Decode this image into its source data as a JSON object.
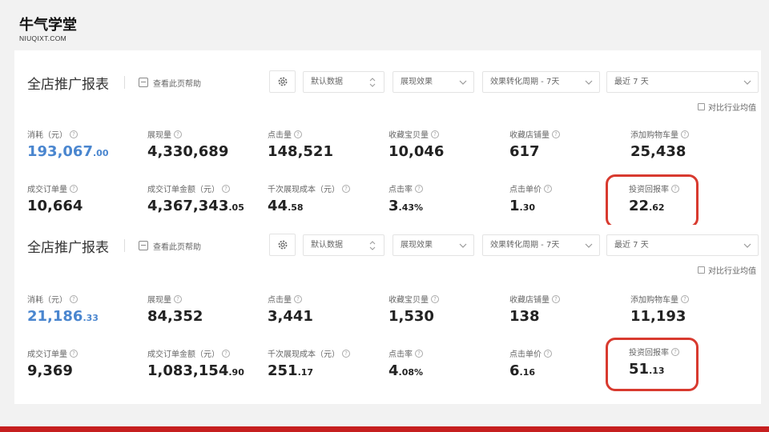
{
  "logo": {
    "main": "牛气学堂",
    "sub": "NIUQIXT.COM"
  },
  "panels": [
    {
      "title": "全店推广报表",
      "help": "查看此页帮助",
      "selects": [
        "默认数据",
        "展现效果",
        "效果转化周期 - 7天",
        "最近 7 天"
      ],
      "compare": "对比行业均值",
      "metrics": [
        {
          "label": "消耗（元）",
          "main": "193,067",
          "small": ".00"
        },
        {
          "label": "展现量",
          "main": "4,330,689",
          "small": ""
        },
        {
          "label": "点击量",
          "main": "148,521",
          "small": ""
        },
        {
          "label": "收藏宝贝量",
          "main": "10,046",
          "small": ""
        },
        {
          "label": "收藏店铺量",
          "main": "617",
          "small": ""
        },
        {
          "label": "添加购物车量",
          "main": "25,438",
          "small": ""
        },
        {
          "label": "成交订单量",
          "main": "10,664",
          "small": ""
        },
        {
          "label": "成交订单金额（元）",
          "main": "4,367,343",
          "small": ".05"
        },
        {
          "label": "千次展现成本（元）",
          "main": "44",
          "small": ".58"
        },
        {
          "label": "点击率",
          "main": "3",
          "small": ".43%"
        },
        {
          "label": "点击单价",
          "main": "1",
          "small": ".30"
        },
        {
          "label": "投资回报率",
          "main": "22",
          "small": ".62"
        }
      ]
    },
    {
      "title": "全店推广报表",
      "help": "查看此页帮助",
      "selects": [
        "默认数据",
        "展现效果",
        "效果转化周期 - 7天",
        "最近 7 天"
      ],
      "compare": "对比行业均值",
      "metrics": [
        {
          "label": "消耗（元）",
          "main": "21,186",
          "small": ".33"
        },
        {
          "label": "展现量",
          "main": "84,352",
          "small": ""
        },
        {
          "label": "点击量",
          "main": "3,441",
          "small": ""
        },
        {
          "label": "收藏宝贝量",
          "main": "1,530",
          "small": ""
        },
        {
          "label": "收藏店铺量",
          "main": "138",
          "small": ""
        },
        {
          "label": "添加购物车量",
          "main": "11,193",
          "small": ""
        },
        {
          "label": "成交订单量",
          "main": "9,369",
          "small": ""
        },
        {
          "label": "成交订单金额（元）",
          "main": "1,083,154",
          "small": ".90"
        },
        {
          "label": "千次展现成本（元）",
          "main": "251",
          "small": ".17"
        },
        {
          "label": "点击率",
          "main": "4",
          "small": ".08%"
        },
        {
          "label": "点击单价",
          "main": "6",
          "small": ".16"
        },
        {
          "label": "投资回报率",
          "main": "51",
          "small": ".13"
        }
      ]
    }
  ],
  "colors": {
    "accent_blue": "#4a86cf",
    "highlight_red": "#d83a2f",
    "bottom_bar": "#c61f1f"
  },
  "icons": [
    "help-book-icon",
    "gear-icon",
    "sort-updown-icon",
    "chevron-down-icon",
    "question-icon",
    "checkbox-icon"
  ]
}
